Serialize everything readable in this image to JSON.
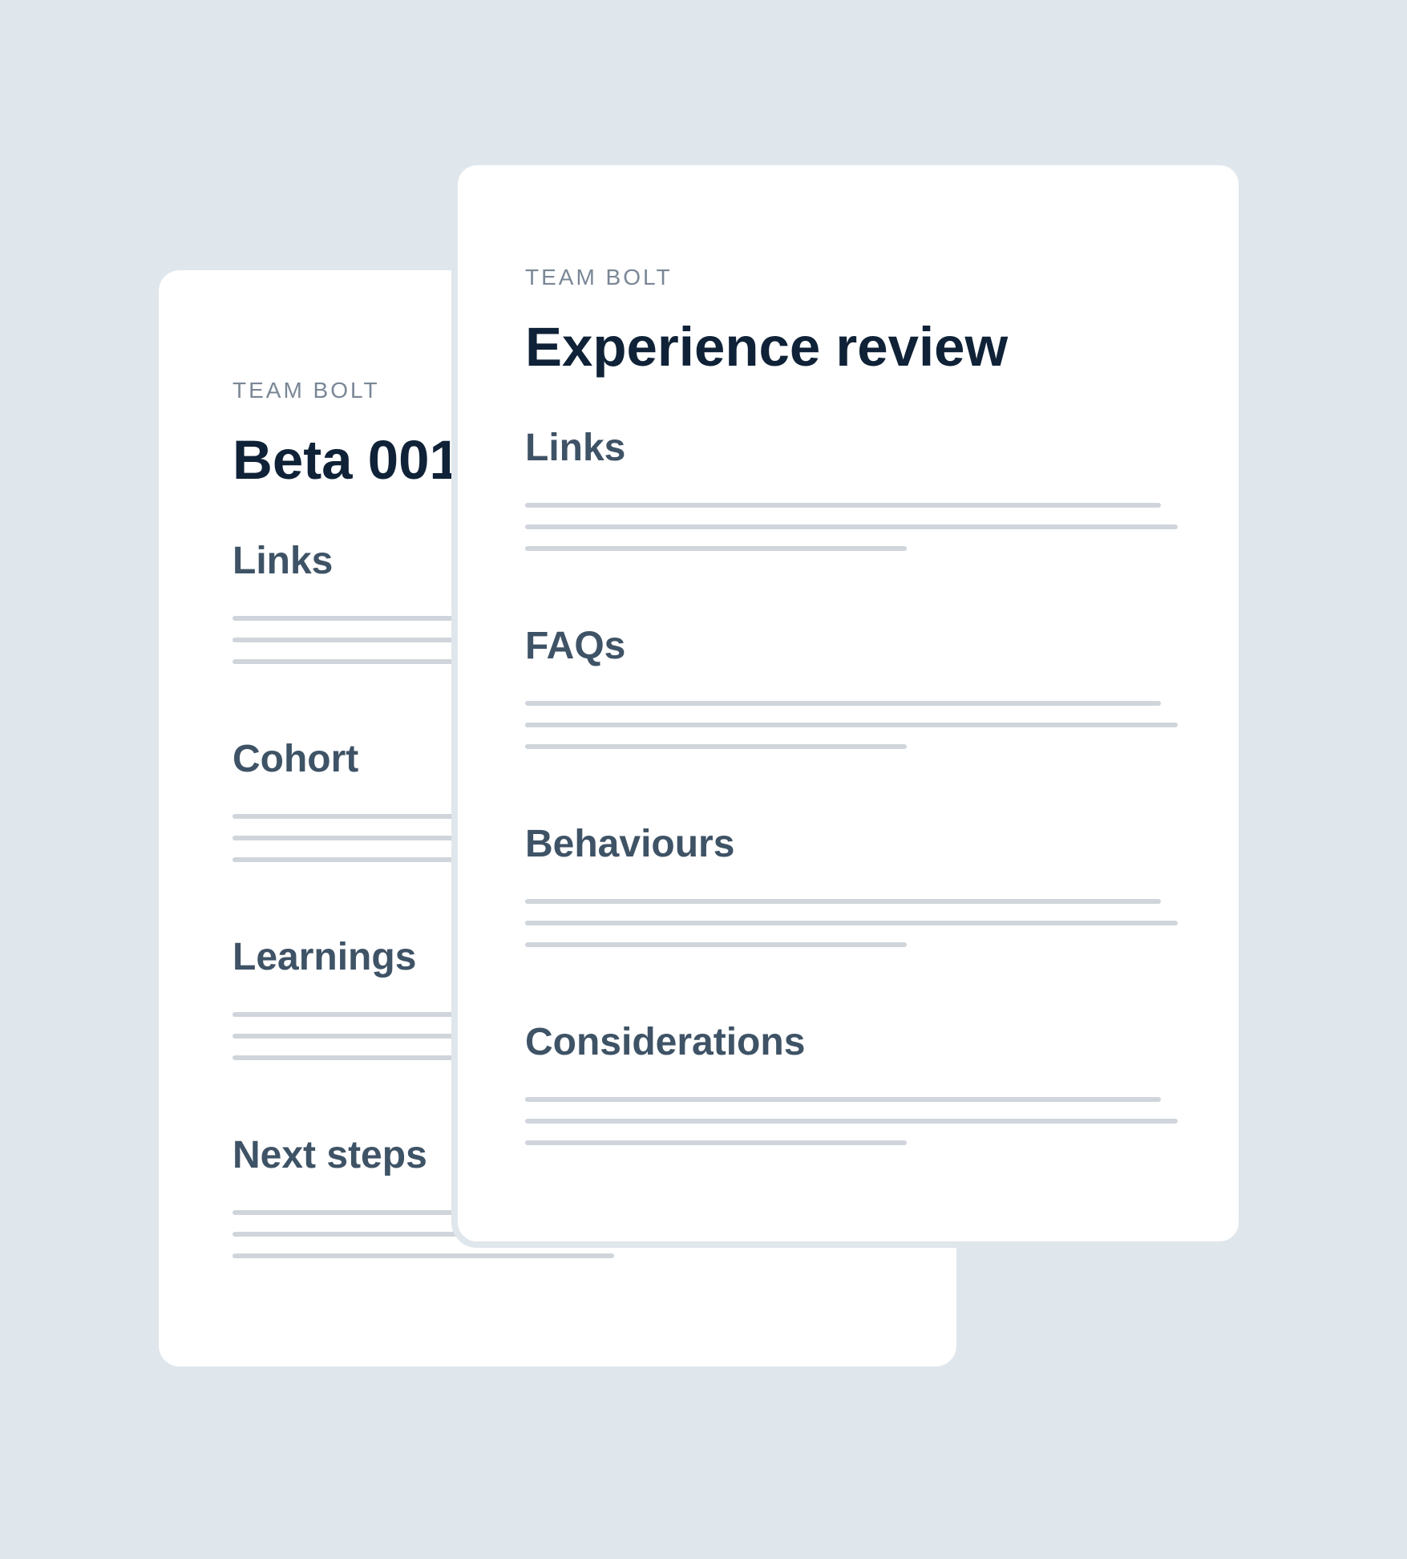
{
  "back_card": {
    "team": "TEAM BOLT",
    "title": "Beta 001",
    "sections": [
      "Links",
      "Cohort",
      "Learnings",
      "Next steps"
    ]
  },
  "front_card": {
    "team": "TEAM BOLT",
    "title": "Experience review",
    "sections": [
      "Links",
      "FAQs",
      "Behaviours",
      "Considerations"
    ]
  },
  "colors": {
    "background": "#dfe6ec",
    "card": "#ffffff",
    "title": "#0f2237",
    "section": "#3f5366",
    "eyebrow": "#7a8796",
    "placeholder_line": "#cfd5db"
  }
}
